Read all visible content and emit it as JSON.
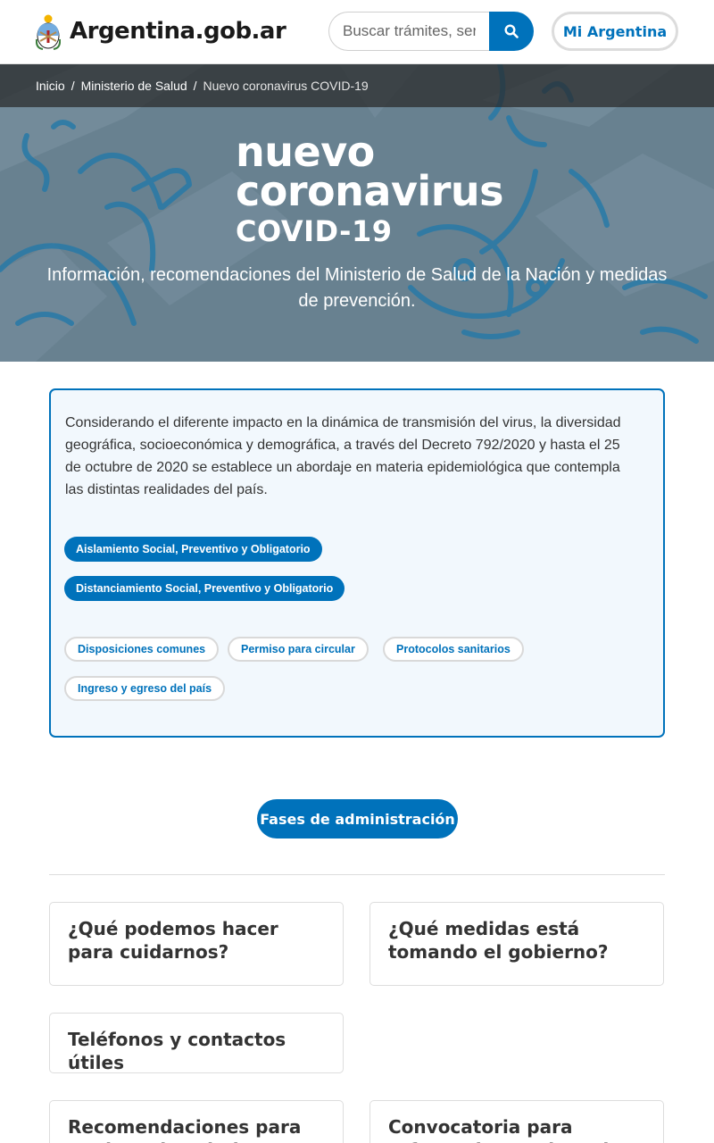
{
  "header": {
    "site_name": "Argentina.gob.ar",
    "search_placeholder": "Buscar trámites, servicios o áreas",
    "account_button": "Mi Argentina"
  },
  "breadcrumb": {
    "items": [
      "Inicio",
      "Ministerio de Salud",
      "Nuevo coronavirus COVID-19"
    ]
  },
  "hero": {
    "title_line1": "nuevo",
    "title_line2": "coronavirus",
    "subtitle": "COVID-19",
    "description": "Información, recomendaciones del Ministerio de Salud de la Nación y medidas de prevención."
  },
  "info_box": {
    "text": "Considerando el diferente impacto en la dinámica de transmisión del virus, la diversidad geográfica, socioeconómica y demográfica, a través del Decreto 792/2020 y hasta el 25 de octubre de 2020 se establece un abordaje en materia epidemiológica que contempla las distintas realidades del país.",
    "primary_pills": [
      "Aislamiento Social, Preventivo y Obligatorio",
      "Distanciamiento Social, Preventivo y Obligatorio"
    ],
    "secondary_pills": [
      "Disposiciones comunes",
      "Permiso para circular",
      "Protocolos sanitarios",
      "Ingreso y egreso del país"
    ]
  },
  "fases_button": "Fases de administración",
  "cards": [
    "¿Qué podemos hacer para cuidarnos?",
    "¿Qué medidas está tomando el gobierno?",
    "Teléfonos y contactos útiles",
    "Recomendaciones para equipos de salud",
    "Convocatoria para reforzar los equipos de salud"
  ],
  "colors": {
    "primary": "#0072bb",
    "hero_overlay": "#6d8593",
    "info_bg": "#f2f8fd"
  },
  "icons": {
    "logo": "coat-of-arms-icon",
    "search": "search-icon"
  }
}
